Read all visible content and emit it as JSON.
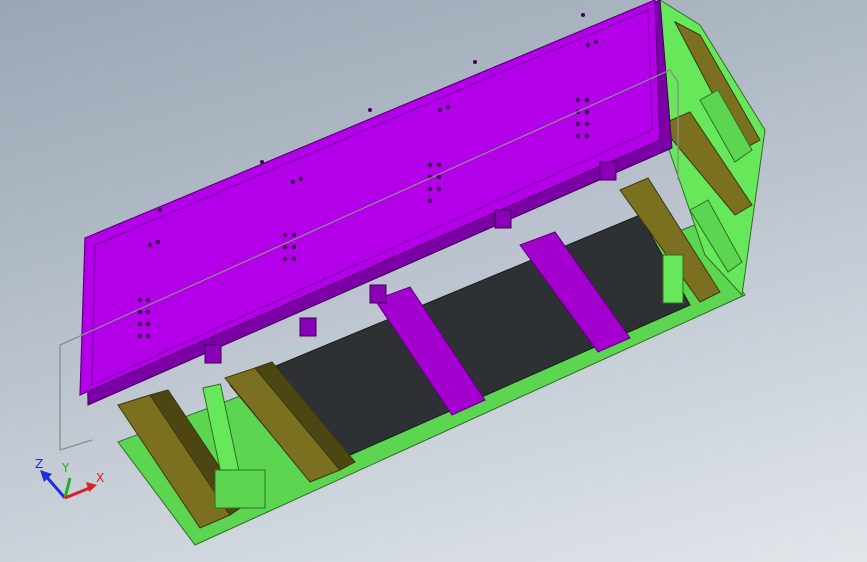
{
  "viewport": {
    "background_top": "#9aa6b5",
    "background_bottom": "#e2e6eb"
  },
  "colors": {
    "panel_top": "#b300e8",
    "panel_edge": "#7a00a6",
    "frame_green": "#66e85a",
    "frame_green_dark": "#3f9c36",
    "olive_rail": "#7a7020",
    "olive_dark": "#4c4612",
    "dark_floor": "#2e3133",
    "purple_beam": "#a300cf"
  },
  "triad": {
    "z_label": "Z",
    "y_label": "Y",
    "x_label": "X",
    "z_color": "#1c2fd8",
    "y_color": "#22b022",
    "x_color": "#d82020"
  }
}
